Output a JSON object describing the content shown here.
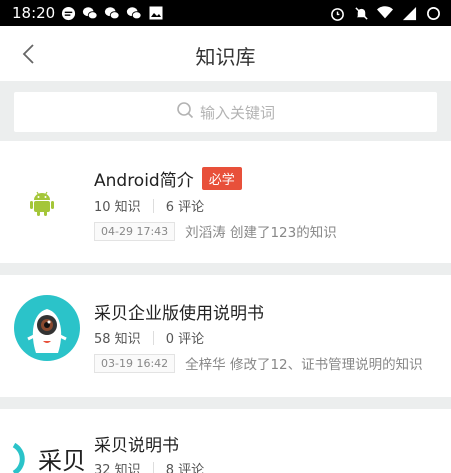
{
  "status_bar": {
    "time": "18:20",
    "left_icons": [
      "message-icon",
      "wechat-icon",
      "wechat-icon",
      "wechat-icon",
      "image-icon"
    ],
    "right_icons": [
      "alarm-icon",
      "mute-icon",
      "wifi-icon",
      "signal-icon",
      "battery-icon"
    ]
  },
  "header": {
    "title": "知识库"
  },
  "search": {
    "placeholder": "输入关键词"
  },
  "cards": [
    {
      "title": "Android简介",
      "tag": "必学",
      "knowledge_count": "10 知识",
      "comment_count": "6 评论",
      "timestamp": "04-29 17:43",
      "activity": "刘滔涛 创建了123的知识",
      "avatar": "android-icon",
      "accent": "#a4c639"
    },
    {
      "title": "采贝企业版使用说明书",
      "knowledge_count": "58 知识",
      "comment_count": "0 评论",
      "timestamp": "03-19 16:42",
      "activity": "全梓华 修改了12、证书管理说明的知识",
      "avatar": "mascot-icon",
      "accent": "#2bc3c9"
    },
    {
      "title": "采贝说明书",
      "knowledge_count": "32 知识",
      "comment_count": "8 评论",
      "avatar": "caibei-logo",
      "logo_text": "采贝",
      "accent": "#2bc3c9"
    }
  ],
  "colors": {
    "tag_red": "#e8503a",
    "background": "#eceeee"
  }
}
